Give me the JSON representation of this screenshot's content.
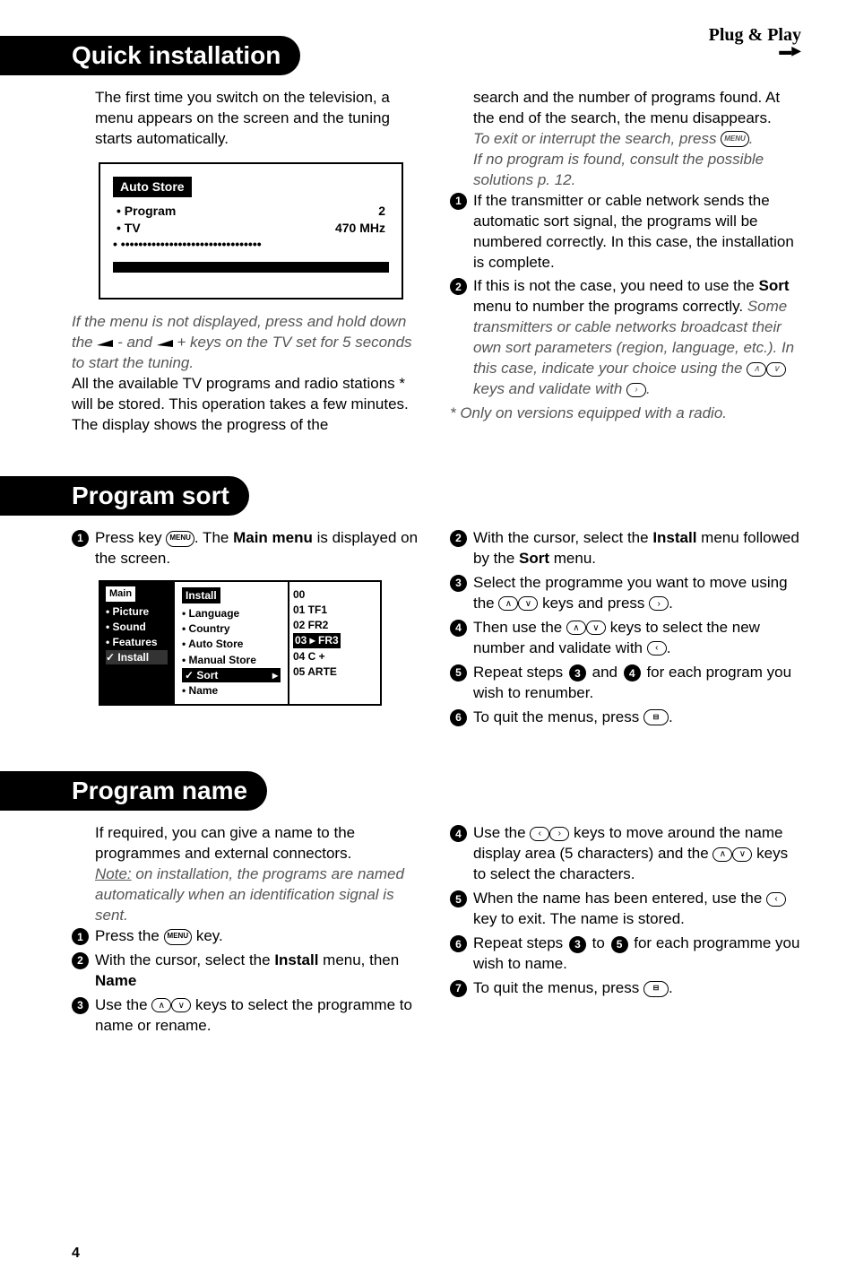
{
  "plug": {
    "text": "Plug & Play"
  },
  "sections": {
    "quick": {
      "title": "Quick installation",
      "left": {
        "intro": "The first time you switch on the television, a menu appears on the screen and the tuning starts automatically.",
        "menubox": {
          "title": "Auto Store",
          "row1l": "•  Program",
          "row1r": "2",
          "row2l": "•  TV",
          "row2r": "470 MHz",
          "row3": "•  ••••••••••••••••••••••••••••••••"
        },
        "note_before": "If the menu is not displayed, press and hold down the ",
        "note_mid": "- and ",
        "note_after": "+ keys on the TV set for 5 seconds to start the tuning.",
        "para2": "All the available TV programs and radio stations * will be stored. This operation takes a few minutes. The display shows the progress of the"
      },
      "right": {
        "cont": "search and the number of programs found. At the end of the search, the menu disappears.",
        "exit_before": "To exit or interrupt the search, press ",
        "exit_after": ".",
        "noprog": "If no program is found, consult the possible solutions p. 12.",
        "item1": "If the transmitter or cable network sends the automatic sort signal, the programs will be numbered correctly. In this case, the installation is complete.",
        "item2a": "If this is not the case, you need to use the ",
        "item2b": "Sort",
        "item2c": " menu to number the programs correctly.",
        "item2note1": "Some transmitters or cable networks broadcast their own sort parameters (region, language, etc.). In this case, indicate your choice using the ",
        "item2note2": " keys and validate with ",
        "item2note3": ".",
        "footnote": "*   Only on versions equipped with a radio."
      }
    },
    "sort": {
      "title": "Program sort",
      "left": {
        "step1a": "Press key ",
        "step1b": ". The ",
        "step1c": "Main menu",
        "step1d": " is displayed on the screen.",
        "diagram": {
          "main_ttl": "Main",
          "main_items": [
            "• Picture",
            "• Sound",
            "• Features",
            "✓ Install"
          ],
          "install_ttl": "Install",
          "install_items": [
            "• Language",
            "• Country",
            "• Auto Store",
            "• Manual Store"
          ],
          "install_sort": "✓ Sort",
          "install_name": "• Name",
          "values": [
            "00",
            "01   TF1",
            "02   FR2",
            "03 ▸ FR3",
            "04   C +",
            "05   ARTE"
          ]
        }
      },
      "right": {
        "step2a": "With the cursor, select the ",
        "step2b": "Install",
        "step2c": " menu followed by the ",
        "step2d": "Sort",
        "step2e": " menu.",
        "step3a": "Select the programme you want to move using the ",
        "step3b": " keys and press ",
        "step3c": ".",
        "step4a": "Then use the ",
        "step4b": " keys to select the new number and validate with ",
        "step4c": ".",
        "step5a": "Repeat steps ",
        "step5b": " and ",
        "step5c": " for each program you wish to renumber.",
        "step6a": "To quit the menus, press ",
        "step6b": "."
      }
    },
    "name": {
      "title": "Program name",
      "left": {
        "intro": "If required, you can give a name to the programmes and external connectors.",
        "note_lbl": "Note:",
        "note": " on installation, the programs are named automatically when an identification signal is sent.",
        "step1a": "Press the ",
        "step1b": " key.",
        "step2a": "With the cursor, select the ",
        "step2b": "Install",
        "step2c": " menu, then ",
        "step2d": "Name",
        "step3a": "Use the ",
        "step3b": " keys to select the programme to name or rename."
      },
      "right": {
        "step4a": "Use the ",
        "step4b": " keys to move around the name display area (5 characters) and the ",
        "step4c": " keys to select the characters.",
        "step5a": "When the name has been entered, use the ",
        "step5b": " key to exit. The name is stored.",
        "step6a": "Repeat steps ",
        "step6b": " to ",
        "step6c": " for each programme you wish to name.",
        "step7a": "To quit the menus, press ",
        "step7b": "."
      }
    }
  },
  "page": "4"
}
